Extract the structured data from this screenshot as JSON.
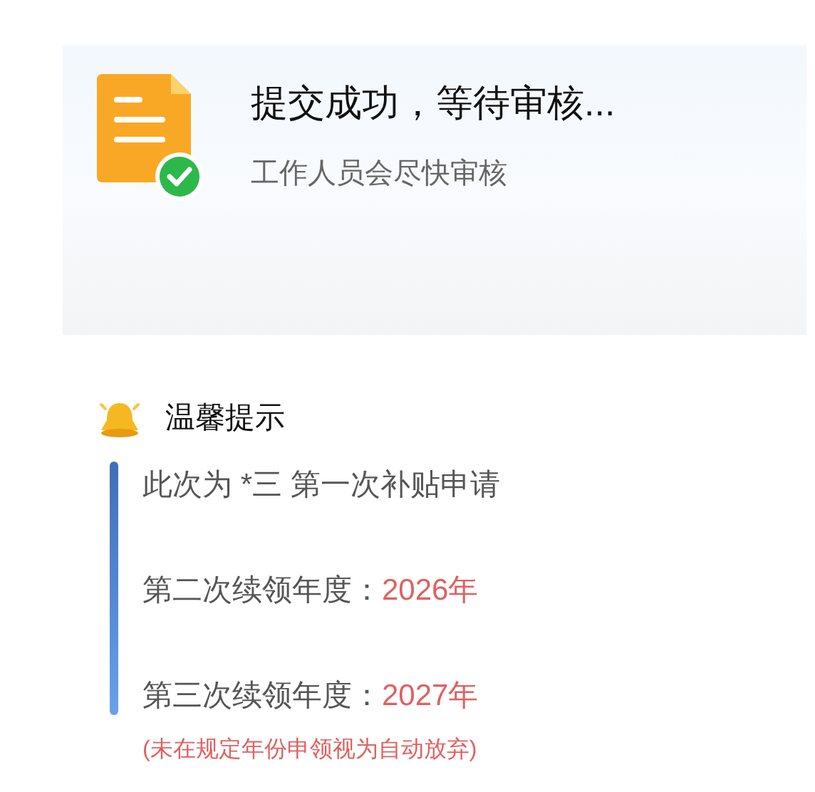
{
  "status_card": {
    "title": "提交成功，等待审核...",
    "subtitle": "工作人员会尽快审核"
  },
  "tips": {
    "title": "温馨提示",
    "items": [
      {
        "label": "此次为 *三 第一次补贴申请"
      },
      {
        "label": "第二次续领年度：",
        "value": "2026年"
      },
      {
        "label": "第三次续领年度：",
        "value": "2027年"
      }
    ],
    "note": "(未在规定年份申领视为自动放弃)"
  }
}
